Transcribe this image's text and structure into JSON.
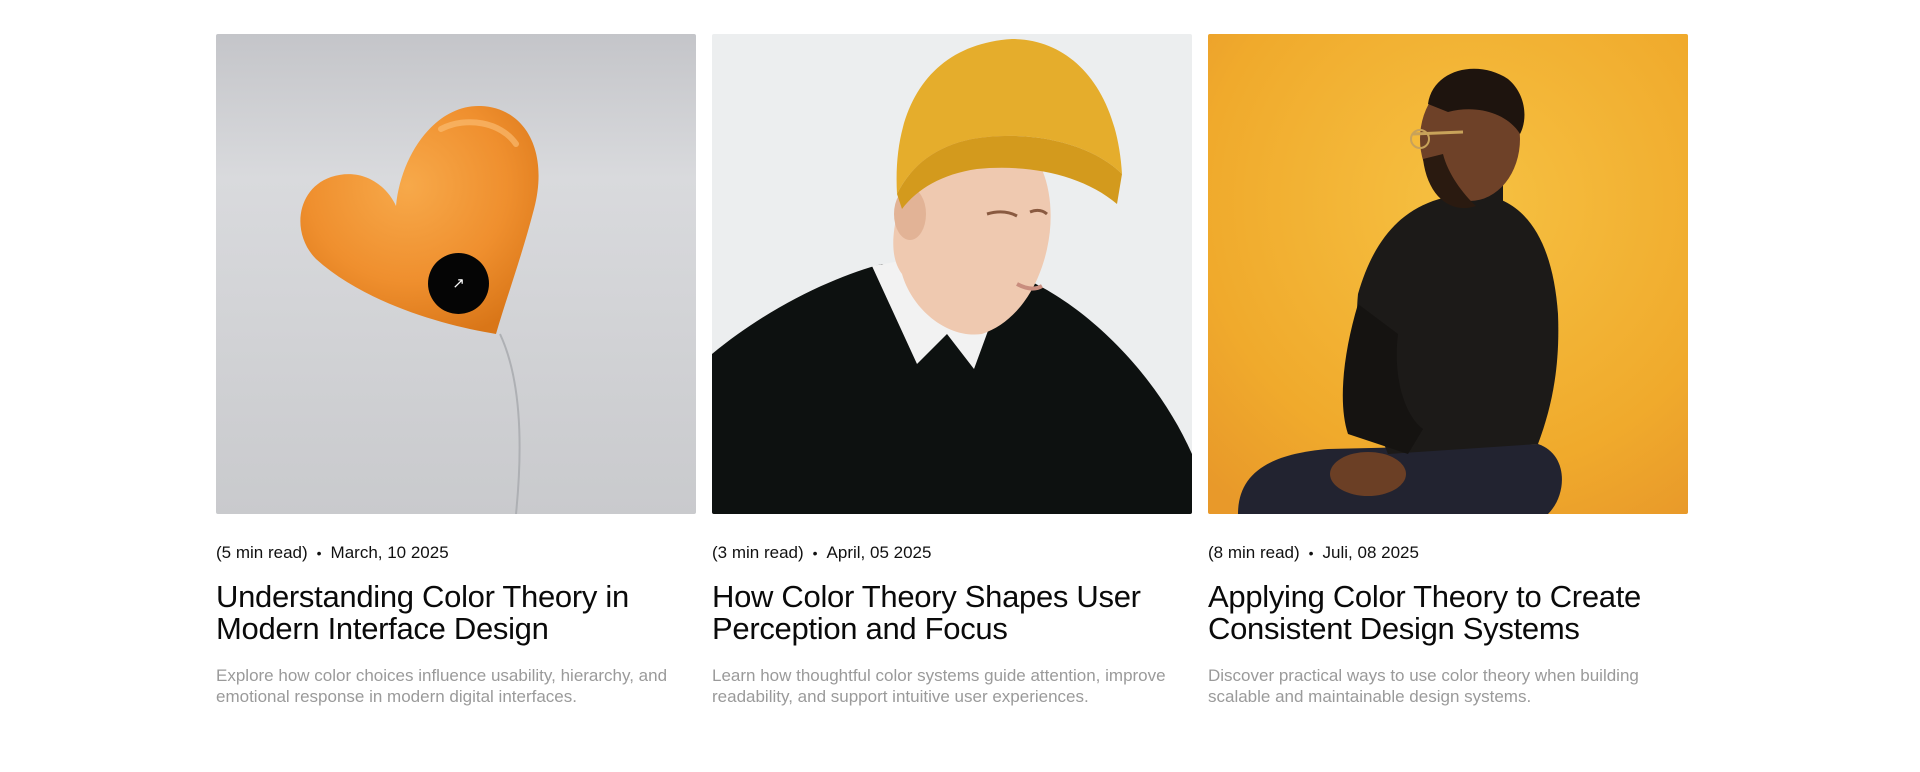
{
  "posts": [
    {
      "read_time": "(5 min read)",
      "separator": "•",
      "date": "March, 10 2025",
      "title": "Understanding Color Theory in Modern Interface Design",
      "description": "Explore how color choices influence usability, hierarchy, and emotional response in modern digital interfaces.",
      "image": "orange-heart-balloon",
      "open_icon": "arrow-up-right-icon",
      "open_glyph": "↗"
    },
    {
      "read_time": "(3 min read)",
      "separator": "•",
      "date": "April, 05 2025",
      "title": "How Color Theory Shapes User Perception and Focus",
      "description": "Learn how thoughtful color systems guide attention, improve readability, and support intuitive user experiences.",
      "image": "man-yellow-beanie"
    },
    {
      "read_time": "(8 min read)",
      "separator": "•",
      "date": "Juli, 08 2025",
      "title": "Applying Color Theory to Create Consistent Design Systems",
      "description": "Discover practical ways to use color theory when building scalable and maintainable design systems.",
      "image": "man-seated-yellow-backdrop"
    }
  ],
  "colors": {
    "accent_orange": "#F29A38",
    "backdrop_yellow": "#F2B53A",
    "muted_text": "#9A9A9A"
  }
}
